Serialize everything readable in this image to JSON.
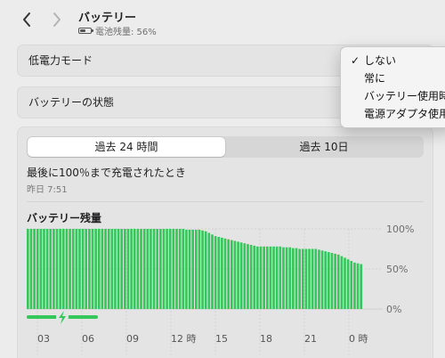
{
  "header": {
    "title": "バッテリー",
    "subtitle": "電池残量: 56%"
  },
  "settings": {
    "low_power_mode": "低電力モード",
    "battery_health": "バッテリーの状態"
  },
  "dropdown": {
    "items": [
      {
        "label": "しない",
        "checked": true
      },
      {
        "label": "常に",
        "checked": false
      },
      {
        "label": "バッテリー使用時",
        "checked": false
      },
      {
        "label": "電源アダプタ使用時",
        "checked": false
      }
    ]
  },
  "usage": {
    "tabs": [
      "過去 24 時間",
      "過去 10日"
    ],
    "active_tab": 0,
    "last_full_charge_label": "最後に100％まで充電されたとき",
    "last_full_charge_time": "昨日 7:51"
  },
  "colors": {
    "bar": "#34c759",
    "bar_edge": "#26b04a",
    "charging_bar": "#34c759"
  },
  "chart_data": {
    "type": "bar",
    "title": "バッテリー残量",
    "ylim": [
      0,
      100
    ],
    "yticks": [
      "100%",
      "50%",
      "0%"
    ],
    "xticks": [
      "03",
      "06",
      "09",
      "12 時",
      "15",
      "18",
      "21",
      "0 時"
    ],
    "values": [
      100,
      100,
      100,
      100,
      100,
      100,
      100,
      100,
      100,
      100,
      100,
      100,
      100,
      100,
      100,
      100,
      100,
      100,
      100,
      100,
      100,
      100,
      100,
      100,
      100,
      100,
      100,
      100,
      100,
      100,
      100,
      100,
      100,
      100,
      100,
      100,
      100,
      100,
      100,
      100,
      100,
      100,
      100,
      100,
      100,
      100,
      100,
      100,
      100,
      99,
      99,
      99,
      99,
      99,
      98,
      97,
      95,
      93,
      91,
      90,
      89,
      88,
      87,
      86,
      85,
      84,
      83,
      82,
      81,
      80,
      79,
      78,
      78,
      78,
      78,
      78,
      78,
      78,
      78,
      77,
      77,
      77,
      76,
      76,
      75,
      75,
      75,
      75,
      75,
      75,
      74,
      73,
      72,
      71,
      70,
      69,
      68,
      66,
      64,
      62,
      60,
      58,
      57,
      56
    ],
    "charging_indicator": "charging"
  }
}
